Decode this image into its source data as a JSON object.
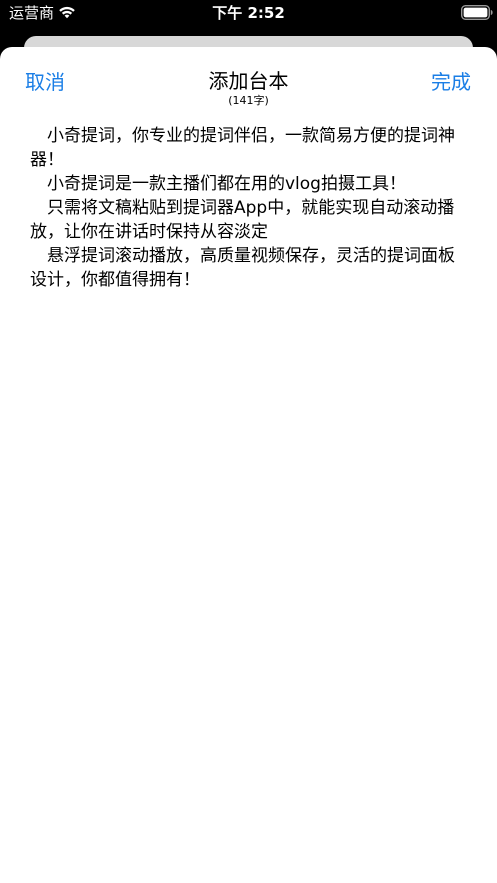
{
  "status_bar": {
    "carrier": "运营商",
    "time": "下午 2:52",
    "wifi_icon": "wifi-icon",
    "battery_icon": "battery-icon"
  },
  "nav": {
    "cancel_label": "取消",
    "title": "添加台本",
    "subtitle": "(141字)",
    "done_label": "完成"
  },
  "editor": {
    "text": "　小奇提词，你专业的提词伴侣，一款简易方便的提词神器！\n　小奇提词是一款主播们都在用的vlog拍摄工具！\n　只需将文稿粘贴到提词器App中，就能实现自动滚动播放，让你在讲话时保持从容淡定\n　悬浮提词滚动播放，高质量视频保存，灵活的提词面板设计，你都值得拥有！"
  },
  "colors": {
    "accent": "#1a7ee6",
    "sheet_background": "#ffffff",
    "status_background": "#000000"
  }
}
